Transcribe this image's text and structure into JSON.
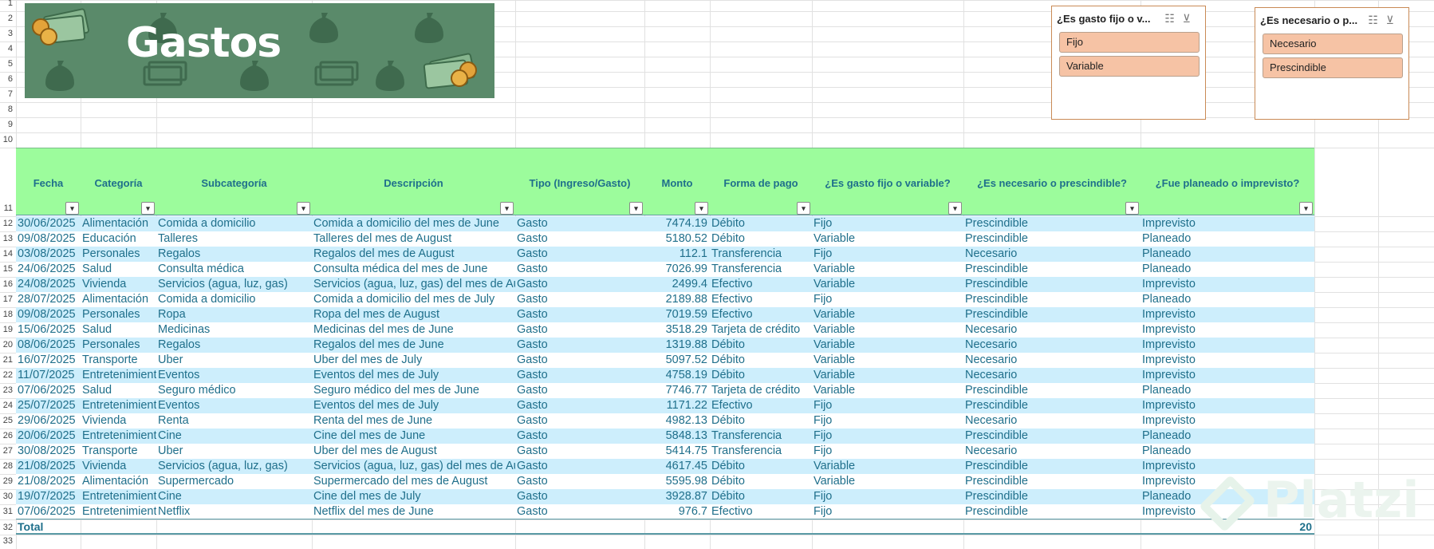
{
  "banner": {
    "title": "Gastos"
  },
  "row_numbers": [
    "1",
    "2",
    "3",
    "4",
    "5",
    "6",
    "7",
    "8",
    "9",
    "10",
    "11",
    "12",
    "13",
    "14",
    "15",
    "16",
    "17",
    "18",
    "19",
    "20",
    "21",
    "22",
    "23",
    "24",
    "25",
    "26",
    "27",
    "28",
    "29",
    "30",
    "31",
    "32",
    "33"
  ],
  "table": {
    "columns": [
      "Fecha",
      "Categoría",
      "Subcategoría",
      "Descripción",
      "Tipo (Ingreso/Gasto)",
      "Monto",
      "Forma de pago",
      "¿Es gasto fijo o variable?",
      "¿Es necesario o prescindible?",
      "¿Fue planeado o imprevisto?"
    ],
    "rows": [
      [
        "30/06/2025",
        "Alimentación",
        "Comida a domicilio",
        "Comida a domicilio del mes de June",
        "Gasto",
        "7474.19",
        "Débito",
        "Fijo",
        "Prescindible",
        "Imprevisto"
      ],
      [
        "09/08/2025",
        "Educación",
        "Talleres",
        "Talleres del mes de August",
        "Gasto",
        "5180.52",
        "Débito",
        "Variable",
        "Prescindible",
        "Planeado"
      ],
      [
        "03/08/2025",
        "Personales",
        "Regalos",
        "Regalos del mes de August",
        "Gasto",
        "112.1",
        "Transferencia",
        "Fijo",
        "Necesario",
        "Planeado"
      ],
      [
        "24/06/2025",
        "Salud",
        "Consulta médica",
        "Consulta médica del mes de June",
        "Gasto",
        "7026.99",
        "Transferencia",
        "Variable",
        "Prescindible",
        "Planeado"
      ],
      [
        "24/08/2025",
        "Vivienda",
        "Servicios (agua, luz, gas)",
        "Servicios (agua, luz, gas) del mes de August",
        "Gasto",
        "2499.4",
        "Efectivo",
        "Variable",
        "Prescindible",
        "Imprevisto"
      ],
      [
        "28/07/2025",
        "Alimentación",
        "Comida a domicilio",
        "Comida a domicilio del mes de July",
        "Gasto",
        "2189.88",
        "Efectivo",
        "Fijo",
        "Prescindible",
        "Planeado"
      ],
      [
        "09/08/2025",
        "Personales",
        "Ropa",
        "Ropa del mes de August",
        "Gasto",
        "7019.59",
        "Efectivo",
        "Variable",
        "Prescindible",
        "Imprevisto"
      ],
      [
        "15/06/2025",
        "Salud",
        "Medicinas",
        "Medicinas del mes de June",
        "Gasto",
        "3518.29",
        "Tarjeta de crédito",
        "Variable",
        "Necesario",
        "Imprevisto"
      ],
      [
        "08/06/2025",
        "Personales",
        "Regalos",
        "Regalos del mes de June",
        "Gasto",
        "1319.88",
        "Débito",
        "Variable",
        "Necesario",
        "Imprevisto"
      ],
      [
        "16/07/2025",
        "Transporte",
        "Uber",
        "Uber del mes de July",
        "Gasto",
        "5097.52",
        "Débito",
        "Variable",
        "Necesario",
        "Imprevisto"
      ],
      [
        "11/07/2025",
        "Entretenimiento",
        "Eventos",
        "Eventos del mes de July",
        "Gasto",
        "4758.19",
        "Débito",
        "Variable",
        "Necesario",
        "Imprevisto"
      ],
      [
        "07/06/2025",
        "Salud",
        "Seguro médico",
        "Seguro médico del mes de June",
        "Gasto",
        "7746.77",
        "Tarjeta de crédito",
        "Variable",
        "Prescindible",
        "Planeado"
      ],
      [
        "25/07/2025",
        "Entretenimiento",
        "Eventos",
        "Eventos del mes de July",
        "Gasto",
        "1171.22",
        "Efectivo",
        "Fijo",
        "Prescindible",
        "Imprevisto"
      ],
      [
        "29/06/2025",
        "Vivienda",
        "Renta",
        "Renta del mes de June",
        "Gasto",
        "4982.13",
        "Débito",
        "Fijo",
        "Necesario",
        "Imprevisto"
      ],
      [
        "20/06/2025",
        "Entretenimiento",
        "Cine",
        "Cine del mes de June",
        "Gasto",
        "5848.13",
        "Transferencia",
        "Fijo",
        "Prescindible",
        "Planeado"
      ],
      [
        "30/08/2025",
        "Transporte",
        "Uber",
        "Uber del mes de August",
        "Gasto",
        "5414.75",
        "Transferencia",
        "Fijo",
        "Necesario",
        "Planeado"
      ],
      [
        "21/08/2025",
        "Vivienda",
        "Servicios (agua, luz, gas)",
        "Servicios (agua, luz, gas) del mes de August",
        "Gasto",
        "4617.45",
        "Débito",
        "Variable",
        "Prescindible",
        "Imprevisto"
      ],
      [
        "21/08/2025",
        "Alimentación",
        "Supermercado",
        "Supermercado del mes de August",
        "Gasto",
        "5595.98",
        "Débito",
        "Variable",
        "Prescindible",
        "Imprevisto"
      ],
      [
        "19/07/2025",
        "Entretenimiento",
        "Cine",
        "Cine del mes de July",
        "Gasto",
        "3928.87",
        "Débito",
        "Fijo",
        "Prescindible",
        "Planeado"
      ],
      [
        "07/06/2025",
        "Entretenimiento",
        "Netflix",
        "Netflix del mes de June",
        "Gasto",
        "976.7",
        "Efectivo",
        "Fijo",
        "Prescindible",
        "Imprevisto"
      ]
    ],
    "total_label": "Total",
    "total_value": "20"
  },
  "slicers": [
    {
      "title": "¿Es gasto fijo o v...",
      "items": [
        "Fijo",
        "Variable"
      ]
    },
    {
      "title": "¿Es necesario o p...",
      "items": [
        "Necesario",
        "Prescindible"
      ]
    }
  ],
  "watermark": "Platzi",
  "colors": {
    "header_fill": "#9cfc9c",
    "band_fill": "#cdeefc",
    "banner_fill": "#5a8a6a",
    "slicer_item_fill": "#f6c3a5",
    "text": "#1f6f8b"
  }
}
